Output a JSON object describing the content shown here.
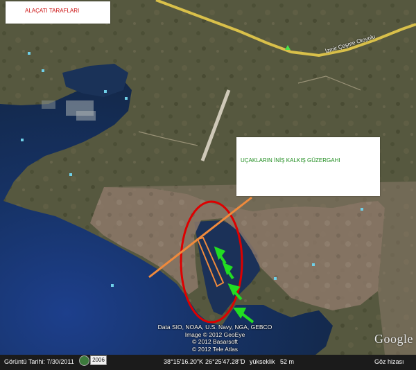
{
  "annotations": {
    "alacati_label": "ALAÇATI TARAFLARI",
    "runway_label": "UÇAKLARIN İNİŞ KALKIŞ GÜZERGAHI"
  },
  "road": {
    "name": "İzmir Çeşme Otoyolu"
  },
  "credits": {
    "line1": "Data SIO, NOAA, U.S. Navy, NGA, GEBCO",
    "line2": "Image © 2012 GeoEye",
    "line3": "© 2012 Basarsoft",
    "line4": "© 2012 Tele Atlas"
  },
  "logo": {
    "text": "Google"
  },
  "status": {
    "imagery_date": "Görüntü Tarihi: 7/30/2011",
    "year_button": "2006",
    "latitude": "38°15'16.20\"K",
    "longitude": "26°25'47.28\"D",
    "elevation_label": "yükseklik",
    "elevation_value": "52 m",
    "eye_alt_label": "Göz hizası"
  },
  "colors": {
    "annotation_red": "#cc1111",
    "annotation_green": "#1e8c1e",
    "ellipse_red": "#dd0000",
    "flight_path_orange": "#f08a3c",
    "arrows_green": "#22dd22",
    "road_yellow": "#d9c04a"
  },
  "icons": {
    "history": "clock-history-icon",
    "placemark": "green-triangle-icon",
    "arrows": "green-arrow-icon"
  }
}
